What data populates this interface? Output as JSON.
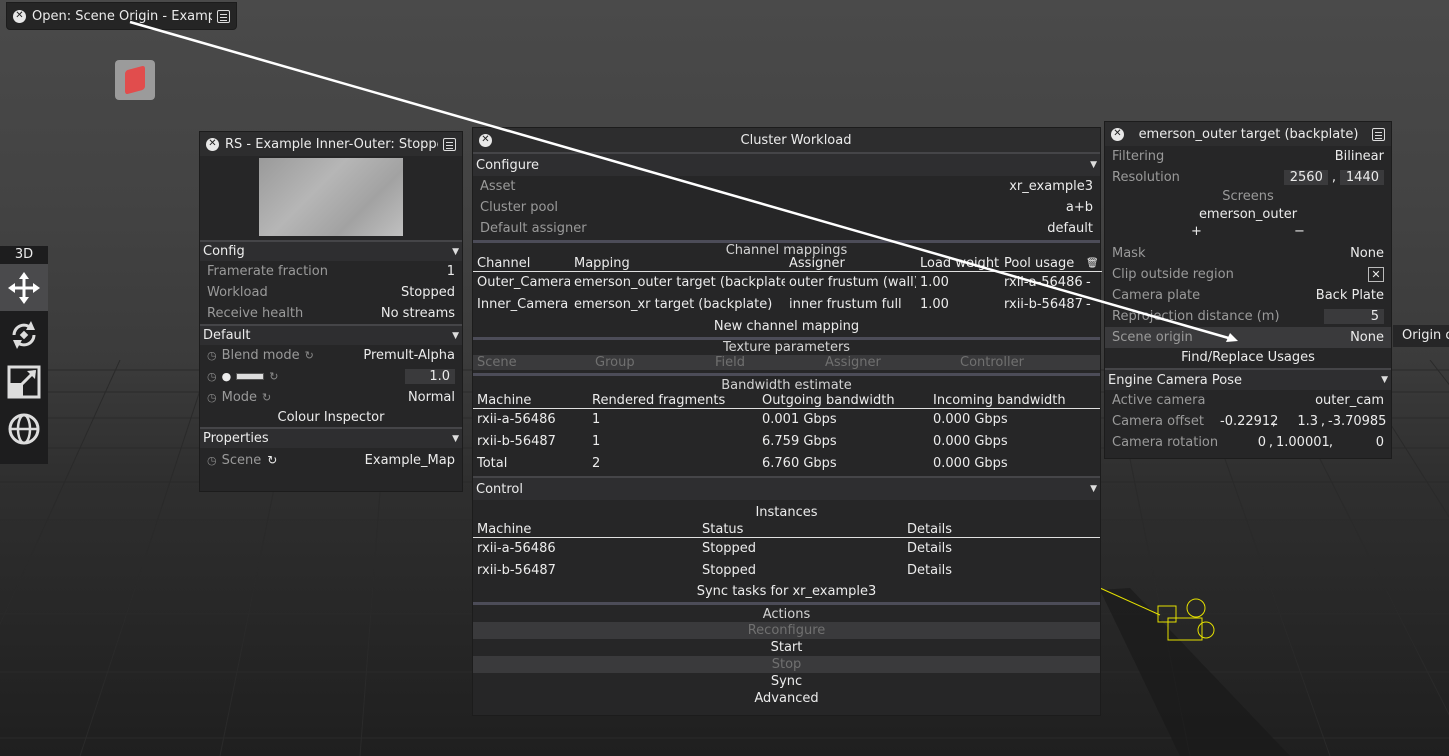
{
  "top_tab": {
    "title": "Open: Scene Origin - Example"
  },
  "rs_panel": {
    "title": "RS - Example Inner-Outer: Stopped",
    "config_header": "Config",
    "config_rows": [
      {
        "label": "Framerate fraction",
        "value": "1"
      },
      {
        "label": "Workload",
        "value": "Stopped"
      },
      {
        "label": "Receive health",
        "value": "No streams"
      }
    ],
    "default_header": "Default",
    "blend_label": "Blend mode",
    "blend_value": "Premult-Alpha",
    "brightness_value": "1.0",
    "mode_label": "Mode",
    "mode_value": "Normal",
    "colour_inspector": "Colour Inspector",
    "properties_header": "Properties",
    "scene_label": "Scene",
    "scene_value": "Example_Map"
  },
  "cluster": {
    "title": "Cluster Workload",
    "configure_header": "Configure",
    "config_rows": [
      {
        "label": "Asset",
        "value": "xr_example3"
      },
      {
        "label": "Cluster pool",
        "value": "a+b"
      },
      {
        "label": "Default assigner",
        "value": "default"
      }
    ],
    "channel_mappings_title": "Channel mappings",
    "mapping_headers": [
      "Channel",
      "Mapping",
      "Assigner",
      "Load weight",
      "Pool usage"
    ],
    "mappings": [
      {
        "channel": "Outer_Camera",
        "mapping": "emerson_outer target (backplate)",
        "assigner": "outer frustum (wall)",
        "load": "1.00",
        "pool": "rxii-a-56486",
        "dash": "-"
      },
      {
        "channel": "Inner_Camera",
        "mapping": "emerson_xr target (backplate)",
        "assigner": "inner frustum full",
        "load": "1.00",
        "pool": "rxii-b-56487",
        "dash": "-"
      }
    ],
    "new_mapping": "New channel mapping",
    "texture_title": "Texture parameters",
    "texture_headers": [
      "Scene",
      "Group",
      "Field",
      "Assigner",
      "Controller"
    ],
    "bandwidth_title": "Bandwidth estimate",
    "bandwidth_headers": [
      "Machine",
      "Rendered fragments",
      "Outgoing bandwidth",
      "Incoming bandwidth"
    ],
    "bandwidth_rows": [
      {
        "machine": "rxii-a-56486",
        "frags": "1",
        "out": "0.001 Gbps",
        "in": "0.000 Gbps"
      },
      {
        "machine": "rxii-b-56487",
        "frags": "1",
        "out": "6.759 Gbps",
        "in": "0.000 Gbps"
      },
      {
        "machine": "Total",
        "frags": "2",
        "out": "6.760 Gbps",
        "in": "0.000 Gbps"
      }
    ],
    "control_header": "Control",
    "instances_title": "Instances",
    "instance_headers": [
      "Machine",
      "Status",
      "Details"
    ],
    "instances": [
      {
        "machine": "rxii-a-56486",
        "status": "Stopped",
        "details": "Details"
      },
      {
        "machine": "rxii-b-56487",
        "status": "Stopped",
        "details": "Details"
      }
    ],
    "sync_tasks": "Sync tasks for xr_example3",
    "actions_title": "Actions",
    "actions": {
      "reconfigure": "Reconfigure",
      "start": "Start",
      "stop": "Stop",
      "sync": "Sync",
      "advanced": "Advanced"
    }
  },
  "right_panel": {
    "title": "emerson_outer target (backplate)",
    "filtering_label": "Filtering",
    "filtering_value": "Bilinear",
    "resolution_label": "Resolution",
    "res_w": "2560",
    "res_h": "1440",
    "res_sep": ",",
    "screens_title": "Screens",
    "screen_item": "emerson_outer",
    "plus": "+",
    "minus": "−",
    "mask_label": "Mask",
    "mask_value": "None",
    "clip_label": "Clip outside region",
    "plate_label": "Camera plate",
    "plate_value": "Back Plate",
    "reproj_label": "Reprojection distance (m)",
    "reproj_value": "5",
    "origin_label": "Scene origin",
    "origin_value": "None",
    "origin_tooltip": "Origin o",
    "find_replace": "Find/Replace Usages",
    "pose_header": "Engine Camera Pose",
    "active_label": "Active camera",
    "active_value": "outer_cam",
    "offset_label": "Camera offset",
    "offset_x": "-0.22912",
    "offset_y": "1.3",
    "offset_z": "-3.70985",
    "rotation_label": "Camera rotation",
    "rot_x": "0",
    "rot_y": "1.00001",
    "rot_z": "0"
  },
  "toolbar": {
    "mode": "3D",
    "tools": [
      "move-icon",
      "rotate-icon",
      "scale-icon",
      "globe-icon"
    ]
  },
  "colors": {
    "accent_line": "#4c4c58",
    "panel_bg": "#262627",
    "title_bg": "#2d2d2e",
    "camera_wire": "#e4e000"
  }
}
